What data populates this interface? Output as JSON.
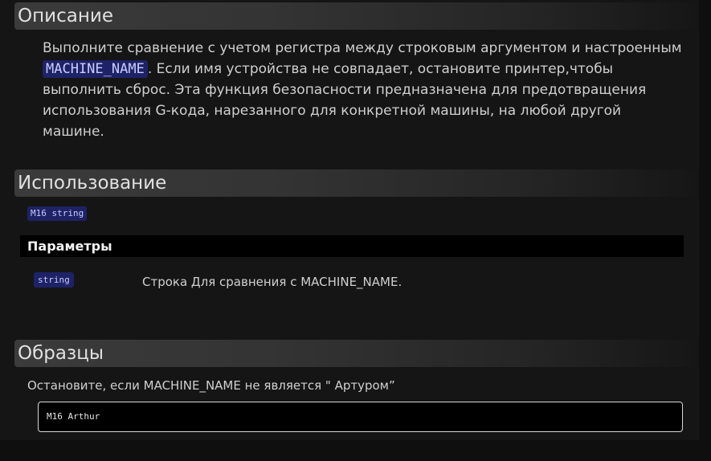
{
  "description": {
    "heading": "Описание",
    "text_before": "Выполните сравнение с учетом регистра между строковым аргументом и настроенным ",
    "code": "MACHINE_NAME",
    "text_after": ". Если имя устройства не совпадает, остановите принтер,чтобы выполнить сброс. Эта функция безопасности предназначена для предотвращения использования G-кода, нарезанного для конкретной машины, на любой другой машине."
  },
  "usage": {
    "heading": "Использование",
    "syntax": "M16 string"
  },
  "parameters": {
    "heading": "Параметры",
    "items": [
      {
        "name": "string",
        "description": "Строка Для сравнения с MACHINE_NAME."
      }
    ]
  },
  "examples": {
    "heading": "Образцы",
    "items": [
      {
        "description": "Остановите, если MACHINE_NAME не является \" Артуром”",
        "code": "M16 Arthur"
      }
    ]
  },
  "colors": {
    "chip_bg": "#1e2266",
    "chip_text": "#c8ccff",
    "page_bg": "#151515"
  }
}
